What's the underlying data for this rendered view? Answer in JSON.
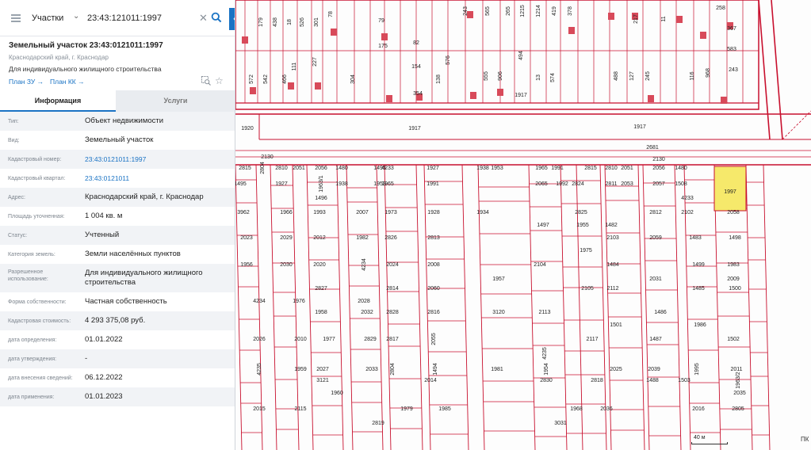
{
  "search": {
    "type": "Участки",
    "value": "23:43:121011:1997",
    "collapse_glyph": "‹"
  },
  "card": {
    "title": "Земельный участок 23:43:0121011:1997",
    "address": "Краснодарский край, г. Краснодар",
    "use": "Для индивидуального жилищного строительства",
    "plan_zu": "План ЗУ →",
    "plan_kk": "План КК →"
  },
  "tabs": {
    "info": "Информация",
    "services": "Услуги"
  },
  "attributes": [
    {
      "label": "Тип:",
      "value": "Объект недвижимости",
      "link": false
    },
    {
      "label": "Вид:",
      "value": "Земельный участок",
      "link": false
    },
    {
      "label": "Кадастровый номер:",
      "value": "23:43:0121011:1997",
      "link": true
    },
    {
      "label": "Кадастровый квартал:",
      "value": "23:43:0121011",
      "link": true
    },
    {
      "label": "Адрес:",
      "value": "Краснодарский край, г. Краснодар",
      "link": false
    },
    {
      "label": "Площадь уточненная:",
      "value": "1 004 кв. м",
      "link": false
    },
    {
      "label": "Статус:",
      "value": "Учтенный",
      "link": false
    },
    {
      "label": "Категория земель:",
      "value": "Земли населённых пунктов",
      "link": false
    },
    {
      "label": "Разрешенное использование:",
      "value": "Для индивидуального жилищного строительства",
      "link": false
    },
    {
      "label": "Форма собственности:",
      "value": "Частная собственность",
      "link": false
    },
    {
      "label": "Кадастровая стоимость:",
      "value": "4 293 375,08 руб.",
      "link": false
    },
    {
      "label": "дата определения:",
      "value": "01.01.2022",
      "link": false
    },
    {
      "label": "дата утверждения:",
      "value": "-",
      "link": false
    },
    {
      "label": "дата внесения сведений:",
      "value": "06.12.2022",
      "link": false
    },
    {
      "label": "дата применения:",
      "value": "01.01.2023",
      "link": false
    }
  ],
  "map": {
    "scale_label": "40 м",
    "corner_label": "ПК",
    "highlight_color": "#f6e96b",
    "boundary_color": "#c8102e",
    "selected_parcel": "1997",
    "top_parcels": [
      "179",
      "438",
      "18",
      "526",
      "301",
      "78",
      "79",
      "175",
      "82",
      "154",
      "138",
      "576",
      "243",
      "565",
      "265",
      "1215",
      "1214",
      "419",
      "378",
      "217",
      "11",
      "258",
      "367",
      "583",
      "243",
      "572",
      "542",
      "466",
      "111",
      "227",
      "304",
      "354",
      "555",
      "906",
      "494",
      "13",
      "574",
      "488",
      "127",
      "245",
      "116",
      "968",
      "1917"
    ],
    "road_labels": [
      "1920",
      "1917",
      "1917",
      "2681",
      "2130",
      "2130"
    ],
    "parcels": [
      "2815",
      "2804",
      "2810",
      "2051",
      "2056",
      "1480",
      "1495",
      "4233",
      "1927",
      "1938",
      "1953",
      "1965",
      "1991",
      "2815",
      "2810",
      "2051",
      "2056",
      "1480",
      "1495",
      "1927",
      "1963/1",
      "1938",
      "1953",
      "1965",
      "1991",
      "2065",
      "1992",
      "2824",
      "2811",
      "2053",
      "2057",
      "1508",
      "1496",
      "4233",
      "3962",
      "1966",
      "1993",
      "2007",
      "1973",
      "1928",
      "1934",
      "2825",
      "2812",
      "2102",
      "2058",
      "1482",
      "1497",
      "1955",
      "2023",
      "2029",
      "2012",
      "1982",
      "2826",
      "2813",
      "2103",
      "2059",
      "1483",
      "1498",
      "1975",
      "1956",
      "2030",
      "2020",
      "4234",
      "2024",
      "2008",
      "2104",
      "1484",
      "1499",
      "1983",
      "1957",
      "2031",
      "2009",
      "2827",
      "2814",
      "2060",
      "2105",
      "2112",
      "1485",
      "1500",
      "4234",
      "1976",
      "2028",
      "1958",
      "2032",
      "2828",
      "2816",
      "3120",
      "2113",
      "1486",
      "1501",
      "1986",
      "2026",
      "2010",
      "1977",
      "2829",
      "2817",
      "2055",
      "2117",
      "1487",
      "1502",
      "4235",
      "4235",
      "1959",
      "2027",
      "2033",
      "2804",
      "1494",
      "1981",
      "1954",
      "2025",
      "2039",
      "1995",
      "2011",
      "3121",
      "2014",
      "2830",
      "2818",
      "1488",
      "1503",
      "1963/2",
      "1960",
      "2035",
      "2015",
      "2115",
      "1979",
      "1985",
      "1968",
      "2036",
      "2016",
      "2805",
      "2819",
      "3031"
    ]
  }
}
